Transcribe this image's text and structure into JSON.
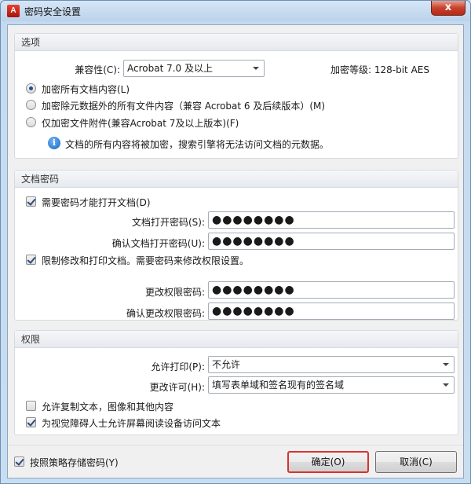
{
  "window": {
    "title": "密码安全设置",
    "close_glyph": "x"
  },
  "options": {
    "header": "选项",
    "compat_label": "兼容性(C):",
    "compat_value": "Acrobat 7.0 及以上",
    "encryption_level": "加密等级: 128-bit AES",
    "radios": [
      {
        "label": "加密所有文档内容(L)",
        "selected": true
      },
      {
        "label": "加密除元数据外的所有文件内容（兼容 Acrobat 6 及后续版本）(M)",
        "selected": false
      },
      {
        "label": "仅加密文件附件(兼容Acrobat 7及以上版本)(F)",
        "selected": false
      }
    ],
    "info_text": "文档的所有内容将被加密，搜索引擎将无法访问文档的元数据。",
    "info_glyph": "i"
  },
  "doc_password": {
    "header": "文档密码",
    "require_open_label": "需要密码才能打开文档(D)",
    "require_open_checked": true,
    "open_pwd_label": "文档打开密码(S):",
    "open_pwd_value": "●●●●●●●●",
    "confirm_open_label": "确认文档打开密码(U):",
    "confirm_open_value": "●●●●●●●●",
    "restrict_label": "限制修改和打印文档。需要密码来修改权限设置。",
    "restrict_checked": true,
    "perm_pwd_label": "更改权限密码:",
    "perm_pwd_value": "●●●●●●●●",
    "confirm_perm_label": "确认更改权限密码:",
    "confirm_perm_value": "●●●●●●●●"
  },
  "permissions": {
    "header": "权限",
    "print_label": "允许打印(P):",
    "print_value": "不允许",
    "change_label": "更改许可(H):",
    "change_value": "填写表单域和签名现有的签名域",
    "copy_label": "允许复制文本，图像和其他内容",
    "copy_checked": false,
    "screenreader_label": "为视觉障碍人士允许屏幕阅读设备访问文本",
    "screenreader_checked": true
  },
  "footer": {
    "store_policy_label": "按照策略存储密码(Y)",
    "store_policy_checked": true,
    "ok_label": "确定(O)",
    "cancel_label": "取消(C)"
  },
  "colors": {
    "highlight": "#d9322f",
    "accent": "#1766c4"
  }
}
